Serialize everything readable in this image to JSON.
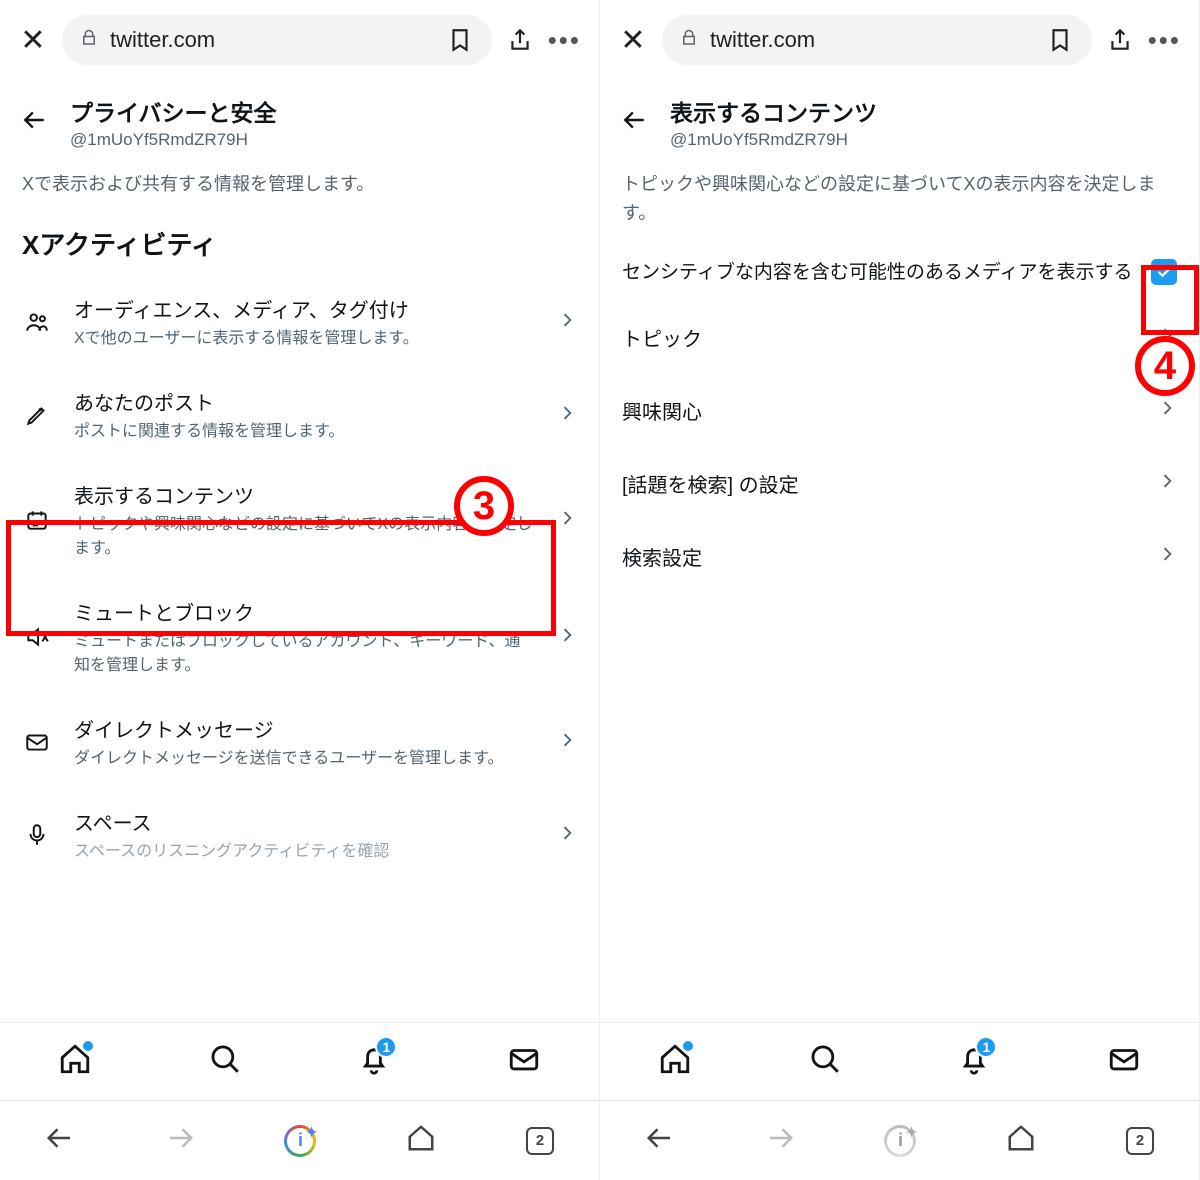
{
  "browser": {
    "url": "twitter.com",
    "tab_count": "2"
  },
  "left": {
    "title": "プライバシーと安全",
    "handle": "@1mUoYf5RmdZR79H",
    "description": "Xで表示および共有する情報を管理します。",
    "section": "Xアクティビティ",
    "items": [
      {
        "title": "オーディエンス、メディア、タグ付け",
        "sub": "Xで他のユーザーに表示する情報を管理します。"
      },
      {
        "title": "あなたのポスト",
        "sub": "ポストに関連する情報を管理します。"
      },
      {
        "title": "表示するコンテンツ",
        "sub": "トピックや興味関心などの設定に基づいてXの表示内容を決定します。"
      },
      {
        "title": "ミュートとブロック",
        "sub": "ミュートまたはブロックしているアカウント、キーワード、通知を管理します。"
      },
      {
        "title": "ダイレクトメッセージ",
        "sub": "ダイレクトメッセージを送信できるユーザーを管理します。"
      },
      {
        "title": "スペース",
        "sub": "スペースのリスニングアクティビティを確認"
      }
    ]
  },
  "right": {
    "title": "表示するコンテンツ",
    "handle": "@1mUoYf5RmdZR79H",
    "description": "トピックや興味関心などの設定に基づいてXの表示内容を決定します。",
    "sensitive_label": "センシティブな内容を含む可能性のあるメディアを表示する",
    "items": [
      {
        "title": "トピック"
      },
      {
        "title": "興味関心"
      },
      {
        "title": "[話題を検索] の設定"
      },
      {
        "title": "検索設定"
      }
    ]
  },
  "nav": {
    "badge": "1"
  },
  "annotations": {
    "step3": "3",
    "step4": "4"
  }
}
